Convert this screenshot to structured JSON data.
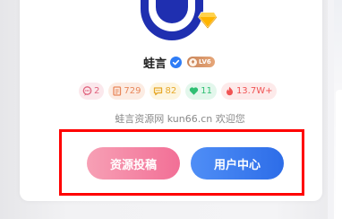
{
  "profile": {
    "name": "蛙言",
    "level": "LV6"
  },
  "stats": {
    "comments": "2",
    "posts": "729",
    "coins": "82",
    "likes": "11",
    "heat": "13.7W+"
  },
  "welcome_text": "蛙言资源网 kun66.cn 欢迎您",
  "buttons": {
    "submit_label": "资源投稿",
    "user_center_label": "用户中心"
  },
  "colors": {
    "avatar_blue": "#1f2fb0",
    "submit_pink": "#f26f96",
    "user_blue": "#2d6de8",
    "highlight_red": "#ff0000"
  }
}
